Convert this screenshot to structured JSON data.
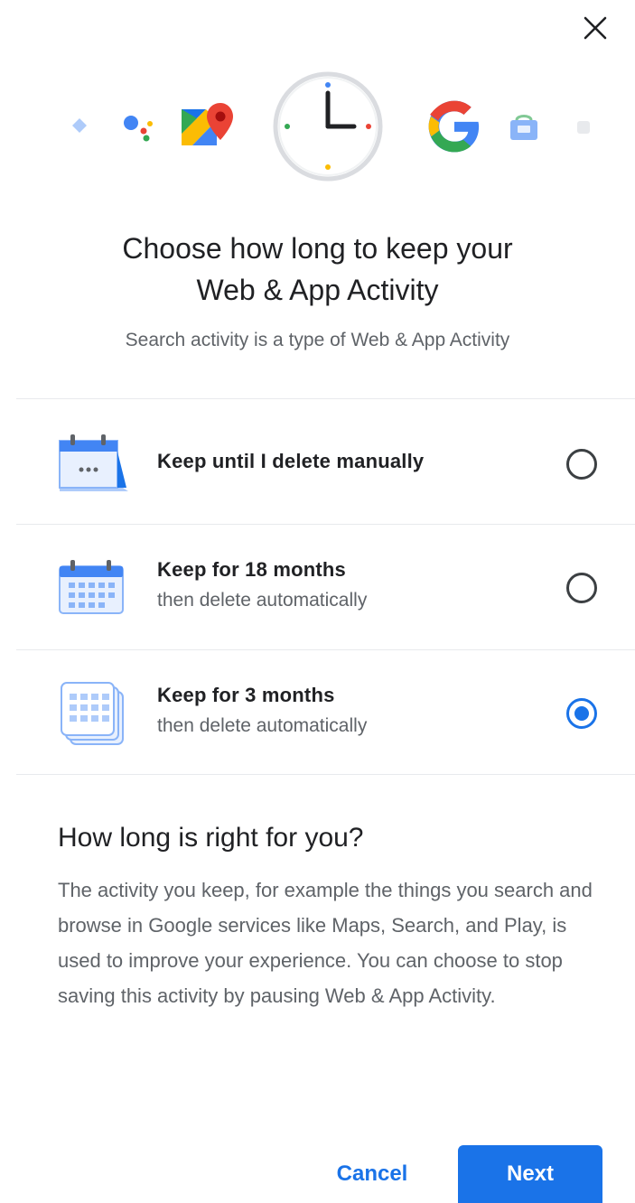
{
  "dialog": {
    "title_line1": "Choose how long to keep your",
    "title_line2": "Web & App Activity",
    "subtitle": "Search activity is a type of Web & App Activity"
  },
  "options": [
    {
      "label": "Keep until I delete manually",
      "sublabel": "",
      "selected": false,
      "icon": "calendar-infinite-icon"
    },
    {
      "label": "Keep for 18 months",
      "sublabel": "then delete automatically",
      "selected": false,
      "icon": "calendar-18-months-icon"
    },
    {
      "label": "Keep for 3 months",
      "sublabel": "then delete automatically",
      "selected": true,
      "icon": "calendar-stack-3-months-icon"
    }
  ],
  "info": {
    "heading": "How long is right for you?",
    "body": "The activity you keep, for example the things you search and browse in Google services like Maps, Search, and Play, is used to improve your experience. You can choose to stop saving this activity by pausing Web & App Activity."
  },
  "buttons": {
    "cancel": "Cancel",
    "next": "Next"
  },
  "icons": [
    "close-icon",
    "clock-icon",
    "google-maps-icon",
    "google-g-icon",
    "google-assistant-icon",
    "shopping-icon"
  ],
  "colors": {
    "accent": "#1a73e8",
    "text_primary": "#202124",
    "text_secondary": "#5f6368",
    "divider": "#e8eaed"
  }
}
